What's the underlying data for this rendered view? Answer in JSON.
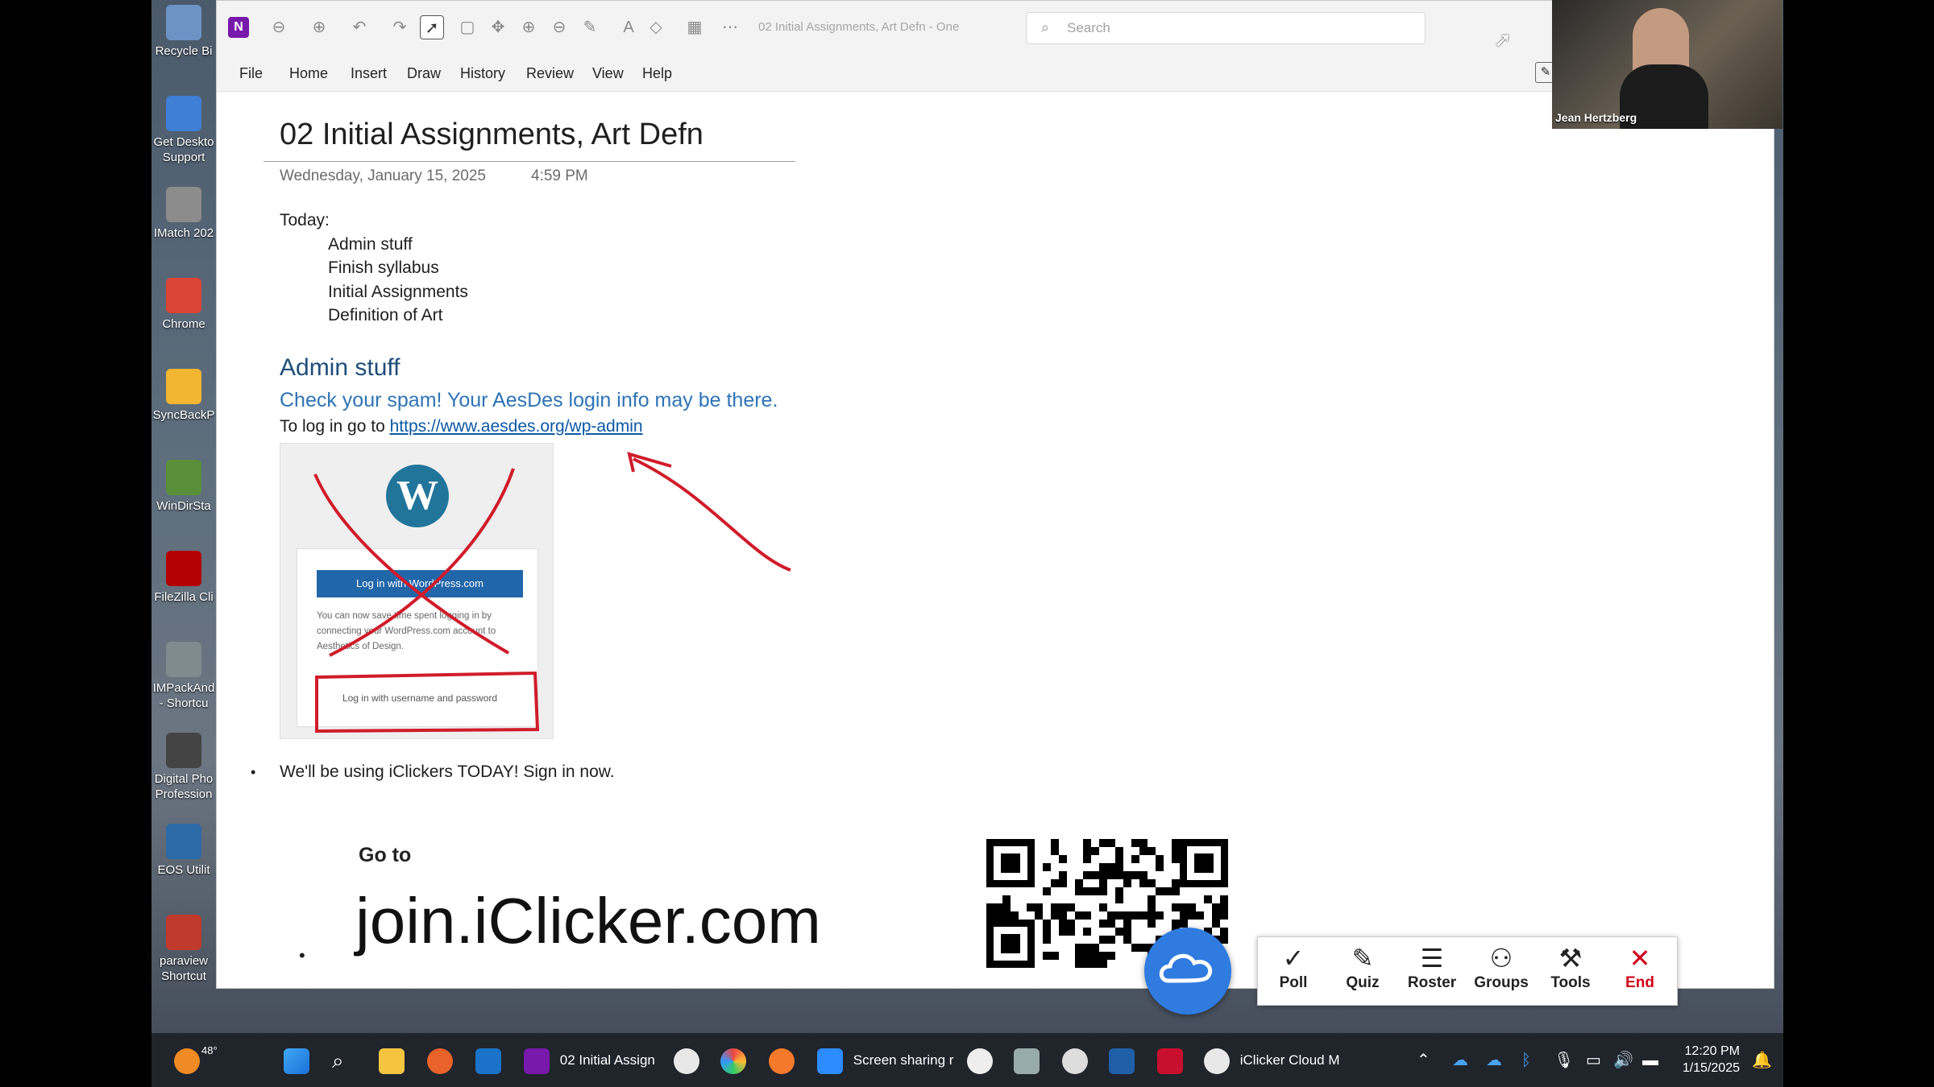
{
  "desktop": {
    "icons": [
      {
        "label": "Recycle Bi",
        "icon": "recycle-bin-icon"
      },
      {
        "label": "Get Deskto Support",
        "icon": "support-icon"
      },
      {
        "label": "IMatch 202",
        "icon": "imatch-icon"
      },
      {
        "label": "Chrome",
        "icon": "chrome-icon"
      },
      {
        "label": "SyncBackP",
        "icon": "syncback-icon"
      },
      {
        "label": "WinDirSta",
        "icon": "windirstat-icon"
      },
      {
        "label": "FileZilla Cli",
        "icon": "filezilla-icon"
      },
      {
        "label": "IMPackAnd - Shortcu",
        "icon": "impack-icon"
      },
      {
        "label": "Digital Pho Profession",
        "icon": "digital-photo-icon"
      },
      {
        "label": "EOS Utilit",
        "icon": "eos-utility-icon"
      },
      {
        "label": "paraview Shortcut",
        "icon": "paraview-icon"
      }
    ]
  },
  "window": {
    "title": "02 Initial Assignments, Art Defn - One",
    "search_placeholder": "Search",
    "menu": [
      "File",
      "Home",
      "Insert",
      "Draw",
      "History",
      "Review",
      "View",
      "Help"
    ]
  },
  "page": {
    "title": "02 Initial Assignments, Art Defn",
    "date": "Wednesday, January 15, 2025",
    "time": "4:59 PM",
    "today_label": "Today:",
    "today_items": [
      "Admin stuff",
      "Finish syllabus",
      "Initial Assignments",
      "Definition of Art"
    ],
    "admin_heading": "Admin stuff",
    "spam_note": "Check your spam! Your AesDes login info may be there.",
    "login_prefix": "To log in go to ",
    "login_url": "https://www.aesdes.org/wp-admin",
    "wp_button": "Log in with WordPress.com",
    "wp_text": "You can now save time spent logging in by connecting your WordPress.com account to Aesthetics of Design.",
    "wp_login_link": "Log in with username and password",
    "iclicker_note": "We'll be using iClickers TODAY! Sign in now.",
    "go_to": "Go to",
    "join_url": "join.iClicker.com"
  },
  "webcam": {
    "name": "Jean Hertzberg"
  },
  "iclicker": {
    "buttons": [
      {
        "label": "Poll",
        "icon": "poll-icon"
      },
      {
        "label": "Quiz",
        "icon": "quiz-icon"
      },
      {
        "label": "Roster",
        "icon": "roster-icon"
      },
      {
        "label": "Groups",
        "icon": "groups-icon"
      },
      {
        "label": "Tools",
        "icon": "tools-icon"
      },
      {
        "label": "End",
        "icon": "close-icon"
      }
    ]
  },
  "taskbar": {
    "weather": "48°",
    "onenote_label": "02 Initial Assign",
    "zoom_label": "Screen sharing r",
    "iclicker_label": "iClicker Cloud M",
    "time": "12:20 PM",
    "date": "1/15/2025"
  },
  "colors": {
    "heading": "#1f4e79",
    "accent_blue": "#2e74b5",
    "ink_red": "#d01c2a",
    "iclicker_blue": "#2f7be0"
  }
}
